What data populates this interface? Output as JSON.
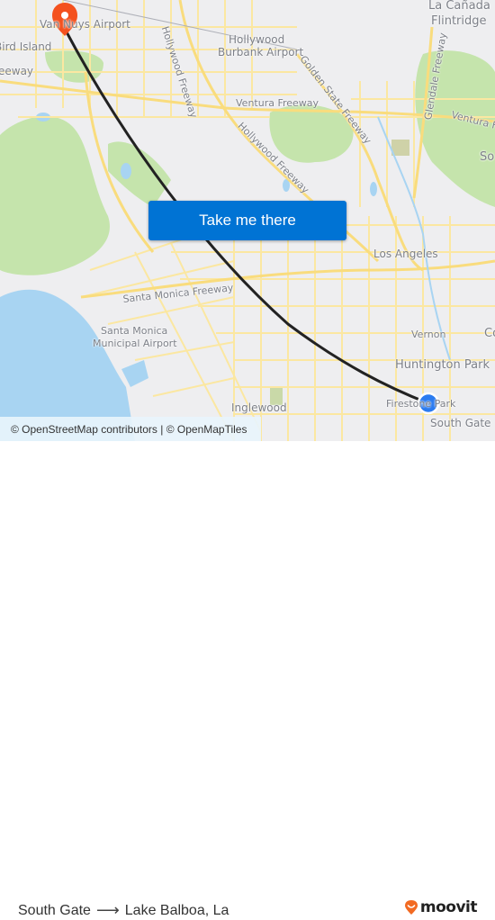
{
  "map": {
    "labels": [
      {
        "id": "van-nuys-airport",
        "text": "Van Nuys Airport"
      },
      {
        "id": "bird-island",
        "text": "Bird Island"
      },
      {
        "id": "freeway-west",
        "text": "eeway"
      },
      {
        "id": "hollywood-freeway-north",
        "text": "Hollywood Freeway"
      },
      {
        "id": "hollywood-burbank-airport-1",
        "text": "Hollywood"
      },
      {
        "id": "hollywood-burbank-airport-2",
        "text": "Burbank Airport"
      },
      {
        "id": "la-canada-1",
        "text": "La Cañada"
      },
      {
        "id": "la-canada-2",
        "text": "Flintridge"
      },
      {
        "id": "golden-state-freeway",
        "text": "Golden State Freeway"
      },
      {
        "id": "glendale-freeway",
        "text": "Glendale Freeway"
      },
      {
        "id": "ventura-freeway",
        "text": "Ventura Freeway"
      },
      {
        "id": "ventura-freeway-east",
        "text": "Ventura Free"
      },
      {
        "id": "hollywood-freeway-south",
        "text": "Hollywood Freeway"
      },
      {
        "id": "so-east",
        "text": "So"
      },
      {
        "id": "los-angeles",
        "text": "Los Angeles"
      },
      {
        "id": "santa-monica-freeway",
        "text": "Santa Monica Freeway"
      },
      {
        "id": "santa-monica-airport-1",
        "text": "Santa Monica"
      },
      {
        "id": "santa-monica-airport-2",
        "text": "Municipal Airport"
      },
      {
        "id": "vernon",
        "text": "Vernon"
      },
      {
        "id": "co-east",
        "text": "Co"
      },
      {
        "id": "huntington-park",
        "text": "Huntington Park"
      },
      {
        "id": "firestone-park",
        "text": "Firestone Park"
      },
      {
        "id": "south-gate",
        "text": "South Gate"
      },
      {
        "id": "inglewood",
        "text": "Inglewood"
      }
    ],
    "origin": "South Gate",
    "destination": "Lake Balboa, La",
    "colors": {
      "route": "#222222",
      "destination_pin": "#f4511e",
      "origin_dot": "#2b7bf0",
      "water": "#a8d4f2",
      "park": "#c5e4ac",
      "road": "#fbe7a1"
    }
  },
  "cta": {
    "label": "Take me there",
    "color": "#0073d4"
  },
  "attribution": "© OpenStreetMap contributors | © OpenMapTiles",
  "footer": {
    "origin": "South Gate",
    "arrow": "⟶",
    "destination": "Lake Balboa, La",
    "brand": "moovit",
    "brand_color": "#f26a22"
  }
}
